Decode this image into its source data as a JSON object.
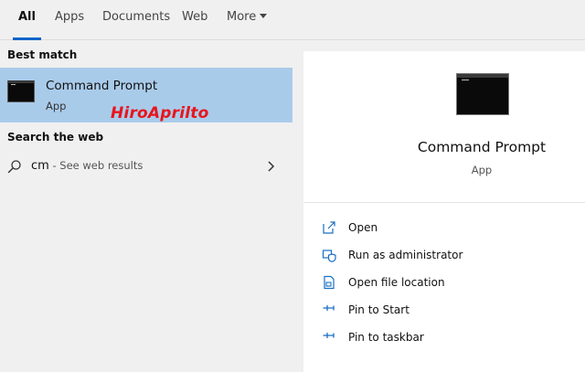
{
  "tabs": {
    "all": "All",
    "apps": "Apps",
    "documents": "Documents",
    "web": "Web",
    "more": "More"
  },
  "left": {
    "best_match_heading": "Best match",
    "best_match": {
      "title": "Command Prompt",
      "subtitle": "App",
      "watermark": "HiroAprilto"
    },
    "search_web_heading": "Search the web",
    "web_result": {
      "query": "cm",
      "suffix": " - See web results"
    }
  },
  "preview": {
    "title": "Command Prompt",
    "subtitle": "App",
    "actions": [
      {
        "label": "Open",
        "icon": "open-icon"
      },
      {
        "label": "Run as administrator",
        "icon": "shield-icon"
      },
      {
        "label": "Open file location",
        "icon": "file-location-icon"
      },
      {
        "label": "Pin to Start",
        "icon": "pin-icon"
      },
      {
        "label": "Pin to taskbar",
        "icon": "pin-icon"
      }
    ]
  },
  "colors": {
    "accent": "#0a64c8",
    "selection": "#a9cbea",
    "watermark": "#e8141c",
    "icon": "#1a6fc4"
  }
}
